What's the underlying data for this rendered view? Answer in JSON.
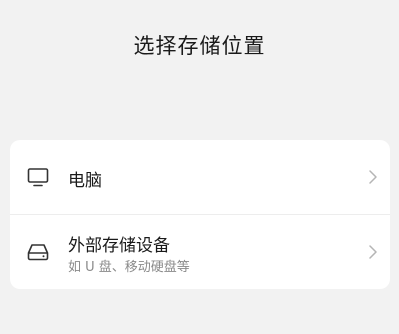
{
  "dialog": {
    "title": "选择存储位置"
  },
  "options": [
    {
      "icon": "monitor-icon",
      "label": "电脑",
      "sublabel": ""
    },
    {
      "icon": "hard-drive-icon",
      "label": "外部存储设备",
      "sublabel": "如 U 盘、移动硬盘等"
    }
  ]
}
